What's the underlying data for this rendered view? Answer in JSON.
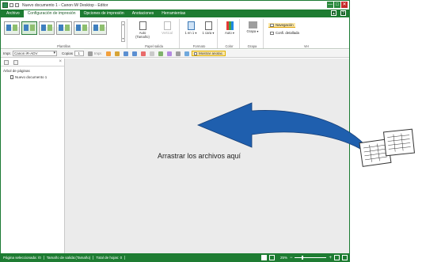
{
  "window": {
    "title": "Nuevo documento 1 - Canon iW Desktop - Editor",
    "controls": [
      "—",
      "□",
      "✕"
    ]
  },
  "tabs": [
    {
      "label": "Archivo"
    },
    {
      "label": "Configuración de impresión"
    },
    {
      "label": "Opciones de impresión"
    },
    {
      "label": "Anotaciones"
    },
    {
      "label": "Herramientas"
    }
  ],
  "tab_help": [
    "?"
  ],
  "ribbon": {
    "groups": {
      "plantillas": "Plantillas",
      "papel_salida": "Papel salida",
      "formato": "Formato",
      "color": "Color",
      "grapa": "Grapa",
      "ver": "Ver"
    },
    "buttons": {
      "auto_size": "Auto (Tamaño)",
      "vertical": "Vertical",
      "n_up": "1 en 1 ▾",
      "duplex": "1 cara ▾",
      "color": "Auto ▾",
      "staple": "Grapa ▾"
    },
    "view": {
      "navigation": "Navegación",
      "detailed": "Confi. detallada"
    }
  },
  "toolbar": {
    "printer_label": "Impr.",
    "printer_value": "Canon iR-ADV",
    "copies_label": "Copias",
    "copies_value": "1",
    "print_label": "Impr.",
    "show_annotations": "Mostrar anotac."
  },
  "sidebar": {
    "title": "Árbol de páginas",
    "items": [
      {
        "label": "Nuevo documento 1"
      }
    ]
  },
  "canvas": {
    "drop_text": "Arrastrar los archivos aquí"
  },
  "status": {
    "selected_page": "Página seleccionada: /0",
    "paper_size": "Tamaño de salida:(Tamaño)",
    "total_sheets": "Total de hojas: 0",
    "zoom": "25%"
  },
  "colors": {
    "brand": "#1e7c32",
    "arrow": "#1f5fae",
    "highlight": "#fde9a9"
  }
}
